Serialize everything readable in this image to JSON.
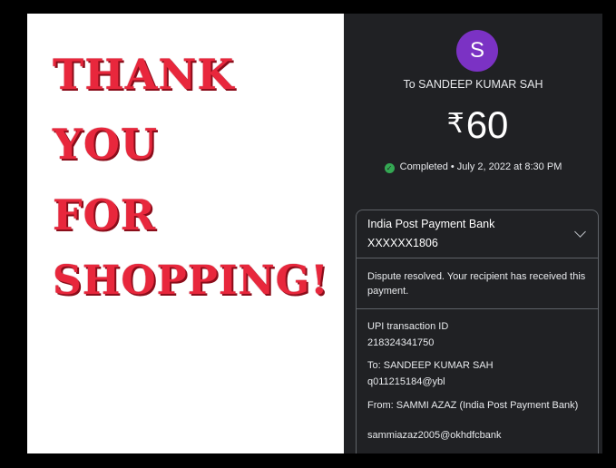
{
  "poster": {
    "line1": "THANK",
    "line2": "YOU",
    "line3": "FOR",
    "line4": "SHOPPING!"
  },
  "payment": {
    "avatar_letter": "S",
    "recipient_title": "To SANDEEP KUMAR SAH",
    "currency_symbol": "₹",
    "amount": "60",
    "status": "Completed • July 2, 2022 at 8:30 PM",
    "bank_name": "India Post Payment Bank",
    "bank_account": "XXXXXX1806",
    "dispute_message": "Dispute resolved. Your recipient has received this payment.",
    "upi_label": "UPI transaction ID",
    "upi_id": "218324341750",
    "to_label": "To: SANDEEP KUMAR SAH",
    "to_upi": "q011215184@ybl",
    "from_label": "From: SAMMI AZAZ (India Post Payment Bank)",
    "from_upi": "sammiazaz2005@okhdfcbank"
  },
  "colors": {
    "poster_text": "#e8273c",
    "panel_bg": "#202124",
    "avatar_bg": "#7b32c4",
    "success": "#34a853"
  }
}
